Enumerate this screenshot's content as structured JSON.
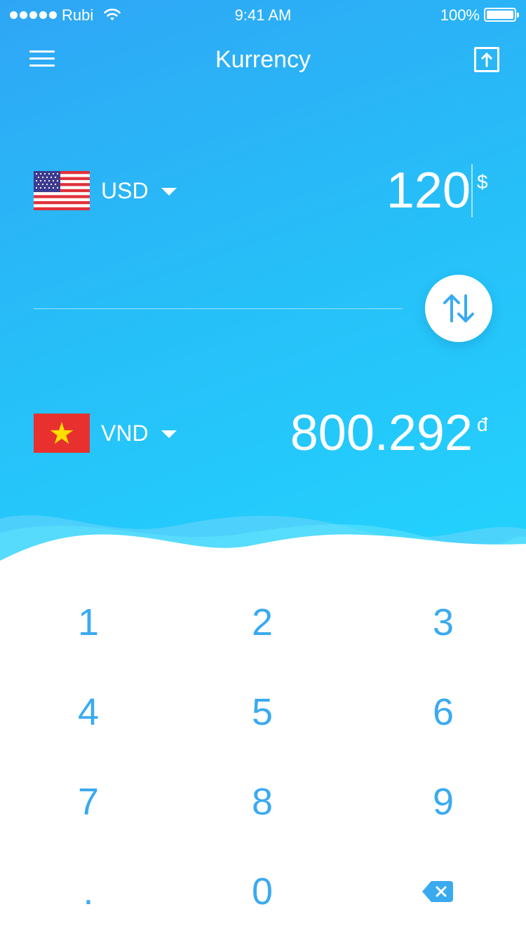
{
  "status_bar": {
    "carrier": "Rubi",
    "time": "9:41 AM",
    "battery": "100%",
    "icons": [
      "signal-dots-icon",
      "wifi-icon",
      "battery-icon"
    ]
  },
  "header": {
    "title": "Kurrency",
    "left_icon": "menu-icon",
    "right_icon": "share-upload-icon"
  },
  "from": {
    "currency": "USD",
    "flag": "us-flag-icon",
    "amount": "120",
    "symbol": "$"
  },
  "to": {
    "currency": "VND",
    "flag": "vn-flag-icon",
    "amount": "800.292",
    "symbol": "đ"
  },
  "swap_icon": "swap-arrows-icon",
  "keypad": {
    "keys": [
      "1",
      "2",
      "3",
      "4",
      "5",
      "6",
      "7",
      "8",
      "9",
      ".",
      "0"
    ],
    "backspace_icon": "backspace-icon"
  },
  "colors": {
    "gradient_start": "#2fa6f5",
    "gradient_end": "#22d3fd",
    "key_text": "#3aaaf0",
    "flag_red": "#e8312f",
    "flag_star": "#ffde00"
  }
}
